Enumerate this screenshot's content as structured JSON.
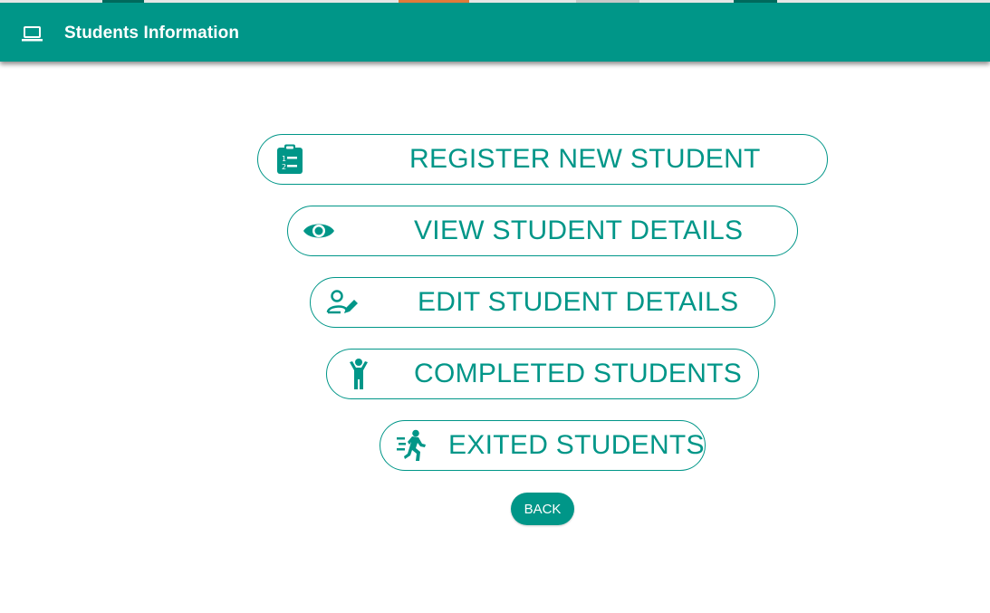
{
  "appbar": {
    "title": "Students Information",
    "icon": "laptop-icon",
    "color": "#009688"
  },
  "menu": {
    "items": [
      {
        "label": "REGISTER NEW STUDENT",
        "icon": "clipboard-list-icon"
      },
      {
        "label": "VIEW STUDENT DETAILS",
        "icon": "eye-icon"
      },
      {
        "label": "EDIT STUDENT DETAILS",
        "icon": "user-edit-icon"
      },
      {
        "label": "COMPLETED STUDENTS",
        "icon": "standing-person-icon"
      },
      {
        "label": "EXITED STUDENTS",
        "icon": "running-person-icon"
      }
    ]
  },
  "back": {
    "label": "BACK"
  }
}
